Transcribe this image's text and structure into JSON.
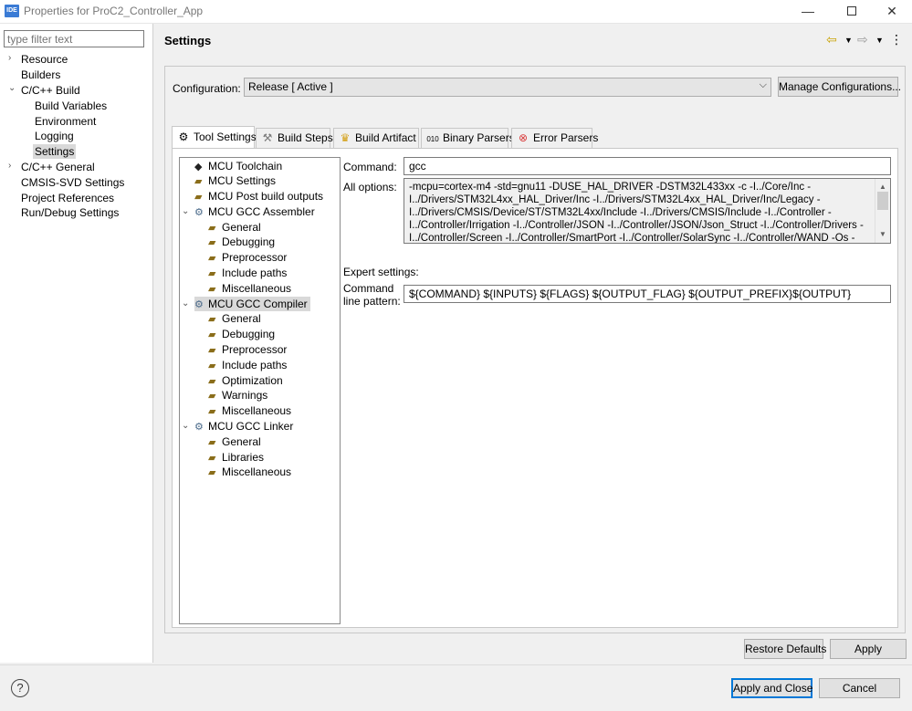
{
  "window": {
    "icon_text": "IDE",
    "title": "Properties for ProC2_Controller_App",
    "minimize": "—",
    "close": "✕"
  },
  "sidebar": {
    "filter_placeholder": "type filter text",
    "items": [
      {
        "label": "Resource",
        "arrow": "›"
      },
      {
        "label": "Builders",
        "arrow": ""
      },
      {
        "label": "C/C++ Build",
        "arrow": "⌄"
      },
      {
        "label": "Build Variables",
        "arrow": ""
      },
      {
        "label": "Environment",
        "arrow": ""
      },
      {
        "label": "Logging",
        "arrow": ""
      },
      {
        "label": "Settings",
        "arrow": ""
      },
      {
        "label": "C/C++ General",
        "arrow": "›"
      },
      {
        "label": "CMSIS-SVD Settings",
        "arrow": ""
      },
      {
        "label": "Project References",
        "arrow": ""
      },
      {
        "label": "Run/Debug Settings",
        "arrow": ""
      }
    ]
  },
  "header": {
    "title": "Settings",
    "icons": [
      "back-arrow",
      "forward-arrow",
      "menu-dots"
    ]
  },
  "configuration": {
    "label": "Configuration:",
    "value": "Release  [ Active ]",
    "manage_button": "Manage Configurations..."
  },
  "tabs": [
    {
      "label": "Tool Settings",
      "icon": "gear-icon"
    },
    {
      "label": "Build Steps",
      "icon": "hammer-icon"
    },
    {
      "label": "Build Artifact",
      "icon": "trophy-icon"
    },
    {
      "label": "Binary Parsers",
      "icon": "binary-icon"
    },
    {
      "label": "Error Parsers",
      "icon": "error-icon"
    }
  ],
  "tool_tree": [
    {
      "label": "MCU Toolchain",
      "level": 0
    },
    {
      "label": "MCU Settings",
      "level": 0
    },
    {
      "label": "MCU Post build outputs",
      "level": 0
    },
    {
      "label": "MCU GCC Assembler",
      "level": 0
    },
    {
      "label": "General",
      "level": 1
    },
    {
      "label": "Debugging",
      "level": 1
    },
    {
      "label": "Preprocessor",
      "level": 1
    },
    {
      "label": "Include paths",
      "level": 1
    },
    {
      "label": "Miscellaneous",
      "level": 1
    },
    {
      "label": "MCU GCC Compiler",
      "level": 0
    },
    {
      "label": "General",
      "level": 1
    },
    {
      "label": "Debugging",
      "level": 1
    },
    {
      "label": "Preprocessor",
      "level": 1
    },
    {
      "label": "Include paths",
      "level": 1
    },
    {
      "label": "Optimization",
      "level": 1
    },
    {
      "label": "Warnings",
      "level": 1
    },
    {
      "label": "Miscellaneous",
      "level": 1
    },
    {
      "label": "MCU GCC Linker",
      "level": 0
    },
    {
      "label": "General",
      "level": 1
    },
    {
      "label": "Libraries",
      "level": 1
    },
    {
      "label": "Miscellaneous",
      "level": 1
    }
  ],
  "tool_settings": {
    "command_label": "Command:",
    "command_value": "gcc",
    "all_options_label": "All options:",
    "all_options_lines": [
      "-mcpu=cortex-m4 -std=gnu11 -DUSE_HAL_DRIVER -DSTM32L433xx -c -I../Core/Inc -",
      "I../Drivers/STM32L4xx_HAL_Driver/Inc -I../Drivers/STM32L4xx_HAL_Driver/Inc/Legacy -",
      "I../Drivers/CMSIS/Device/ST/STM32L4xx/Include -I../Drivers/CMSIS/Include -I../Controller -",
      "I../Controller/Irrigation -I../Controller/JSON -I../Controller/JSON/Json_Struct -I../Controller/Drivers -",
      "I../Controller/Screen -I../Controller/SmartPort -I../Controller/SolarSync -I../Controller/WAND -Os -"
    ],
    "expert_label": "Expert settings:",
    "pattern_label_1": "Command",
    "pattern_label_2": "line pattern:",
    "pattern_value": "${COMMAND} ${INPUTS} ${FLAGS} ${OUTPUT_FLAG} ${OUTPUT_PREFIX}${OUTPUT}"
  },
  "buttons": {
    "restore_defaults": "Restore Defaults",
    "apply": "Apply",
    "apply_and_close": "Apply and Close",
    "cancel": "Cancel",
    "help": "?"
  }
}
